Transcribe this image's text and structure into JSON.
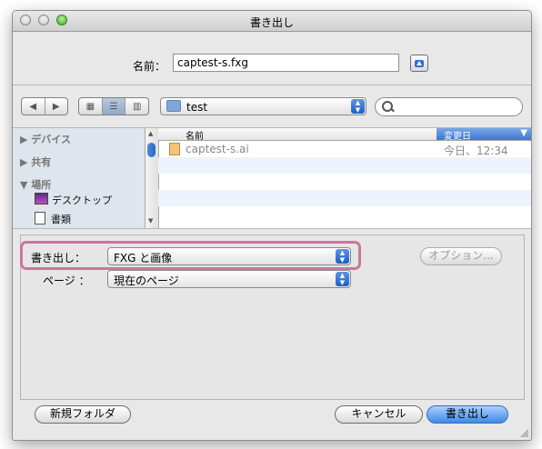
{
  "window": {
    "title": "書き出し"
  },
  "name_row": {
    "label": "名前：",
    "value": "captest-s.fxg"
  },
  "toolbar": {
    "location": "test"
  },
  "sidebar": {
    "sections": [
      {
        "label": "デバイス"
      },
      {
        "label": "共有"
      },
      {
        "label": "場所",
        "items": [
          {
            "label": "デスクトップ",
            "icon": "desktop-icon"
          },
          {
            "label": "書類",
            "icon": "document-icon"
          }
        ]
      }
    ]
  },
  "file_list": {
    "columns": [
      "名前",
      "変更日"
    ],
    "rows": [
      {
        "name": "captest-s.ai",
        "modified": "今日、12:34",
        "icon": "illustrator-file-icon"
      }
    ]
  },
  "options": {
    "export_label": "書き出し：",
    "export_value": "FXG と画像",
    "page_label": "ページ ：",
    "page_value": "現在のページ",
    "options_button": "オプション..."
  },
  "footer": {
    "new_folder": "新規フォルダ",
    "cancel": "キャンセル",
    "export": "書き出し"
  },
  "colors": {
    "highlight": "#c9779b",
    "accent": "#3f8ae6"
  }
}
